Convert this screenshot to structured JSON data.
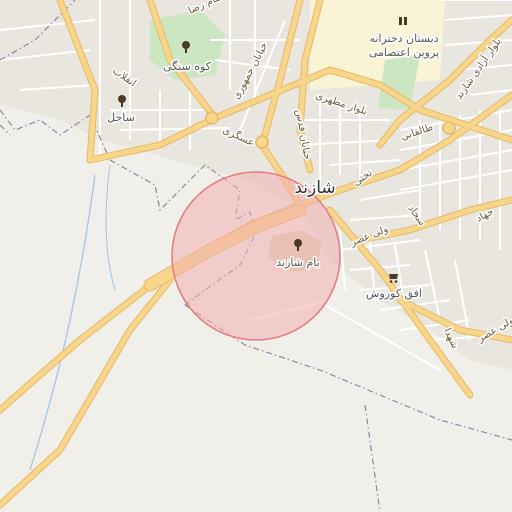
{
  "map": {
    "city_label": "شازند",
    "landmarks": [
      {
        "id": "bam",
        "label": "بام شازند",
        "icon": "tree-icon"
      },
      {
        "id": "kooh",
        "label": "کوه سنگی",
        "icon": "tree-icon"
      },
      {
        "id": "sahel",
        "label": "ساحل",
        "icon": "tree-icon"
      },
      {
        "id": "school",
        "label_line1": "دبستان دخترانه",
        "label_line2": "پروین اعتصامی",
        "icon": "school-icon"
      },
      {
        "id": "ofogh",
        "label": "افق کوروش",
        "icon": "shopping-cart-icon"
      }
    ],
    "streets": {
      "imam_reza": "امام رضا",
      "enghelab": "انقلاب",
      "jomhouri": "خیابان جمهوری",
      "motahari": "بلوار مطهری",
      "ghods": "خیابان قدس",
      "askari": "عسگری",
      "taleghani": "طالقانی",
      "azadi": "بلوار آزادی شازند",
      "takhti": "تختی",
      "sajjad": "سجاد",
      "vali_asr": "ولی عصر",
      "jahad": "جهاد",
      "vali_asr_2": "ولی عصر",
      "shahada": "شهدا"
    },
    "colors": {
      "land": "#f1efe9",
      "major_road": "#f7d58b",
      "major_road_casing": "#e6b965",
      "minor_road": "#ffffff",
      "park": "#cde6c2",
      "school_area": "#faf3d6",
      "boundary": "#8a86a8",
      "highlight_fill": "#f3aeb1",
      "highlight_stroke": "#e57a80",
      "water": "#9ec4e6"
    },
    "highlight": {
      "shape": "circle",
      "target": "بام شازند"
    }
  }
}
